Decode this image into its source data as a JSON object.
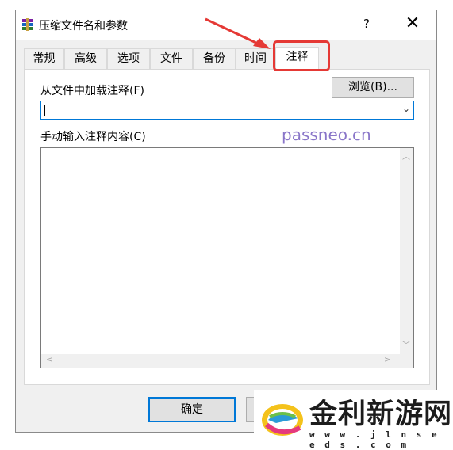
{
  "window": {
    "title": "压缩文件名和参数",
    "help_glyph": "?",
    "close_glyph": "✕"
  },
  "tabs": [
    {
      "label": "常规"
    },
    {
      "label": "高级"
    },
    {
      "label": "选项"
    },
    {
      "label": "文件"
    },
    {
      "label": "备份"
    },
    {
      "label": "时间"
    },
    {
      "label": "注释",
      "active": true
    }
  ],
  "comment_tab": {
    "load_from_file_label": "从文件中加载注释(F)",
    "browse_button": "浏览(B)...",
    "file_value": "",
    "manual_input_label": "手动输入注释内容(C)",
    "comment_text": ""
  },
  "buttons": {
    "ok": "确定"
  },
  "watermark": "passneo.cn",
  "logo": {
    "title": "金利新游网",
    "url": "w w w . j l n s e e d s . c o m"
  },
  "colors": {
    "highlight": "#e53935",
    "accent": "#0078d7",
    "watermark": "#8a76c9"
  },
  "icons": [
    "winrar-app-icon",
    "help-icon",
    "close-icon",
    "chevron-down-icon",
    "scroll-up-icon",
    "scroll-down-icon",
    "scroll-left-icon",
    "scroll-right-icon",
    "red-arrow-annotation",
    "jinli-logo-icon"
  ]
}
